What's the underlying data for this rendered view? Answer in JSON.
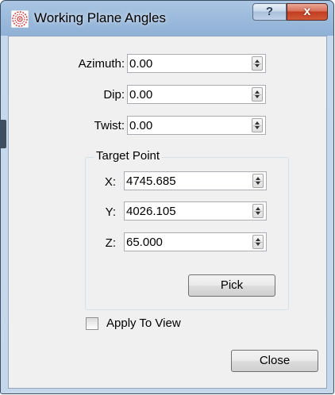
{
  "window": {
    "title": "Working Plane Angles",
    "help_label": "?",
    "close_label": "x",
    "icon": "target-icon"
  },
  "form": {
    "azimuth": {
      "label": "Azimuth:",
      "value": "0.00"
    },
    "dip": {
      "label": "Dip:",
      "value": "0.00"
    },
    "twist": {
      "label": "Twist:",
      "value": "0.00"
    }
  },
  "target_point": {
    "title": "Target Point",
    "x": {
      "label": "X:",
      "value": "4745.685"
    },
    "y": {
      "label": "Y:",
      "value": "4026.105"
    },
    "z": {
      "label": "Z:",
      "value": "65.000"
    },
    "pick_label": "Pick"
  },
  "apply_to_view": {
    "label": "Apply To View",
    "checked": false
  },
  "close_button_label": "Close",
  "colors": {
    "titlebar": "#9dbbdc",
    "close_button": "#c23d1f",
    "dialog_bg": "#f0f0f0"
  }
}
